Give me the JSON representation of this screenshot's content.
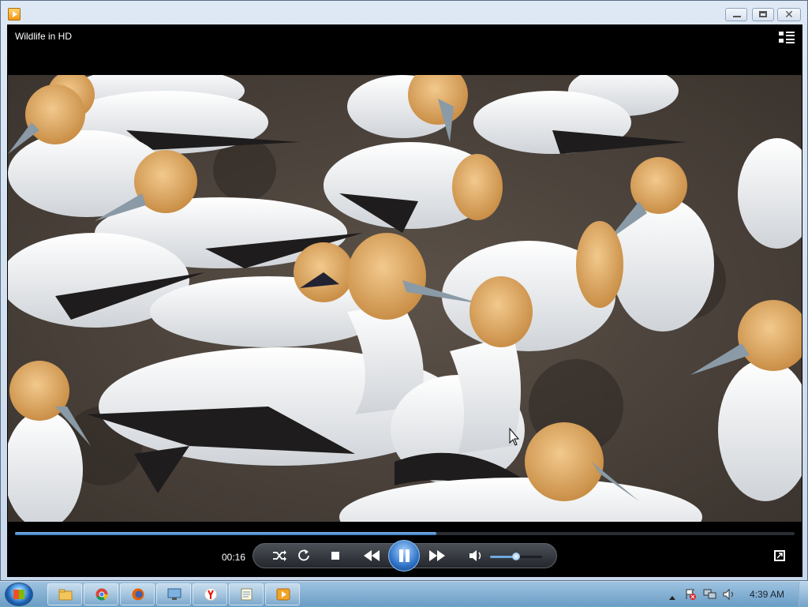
{
  "window": {
    "title": "Wildlife in HD",
    "icon": "media-player-icon",
    "buttons": [
      "minimize-icon",
      "maximize-icon",
      "close-icon"
    ],
    "close_glyph": "✕"
  },
  "player": {
    "current_time": "00:16",
    "progress_fraction": 0.54,
    "volume_fraction": 0.5,
    "state": "playing",
    "controls": [
      "shuffle-icon",
      "repeat-icon",
      "stop-icon",
      "previous-icon",
      "pause-icon",
      "next-icon",
      "volume-icon",
      "fullscreen-icon",
      "switch-to-library-icon"
    ],
    "accent": "#3a79c0"
  },
  "taskbar": {
    "clock": "4:39 AM",
    "pinned": [
      "windows-explorer",
      "google-chrome",
      "firefox",
      "remote-desktop",
      "yandex-browser",
      "notepad",
      "windows-media-player"
    ],
    "tray": [
      "show-hidden-icons",
      "action-center-icon",
      "network-icon",
      "volume-icon"
    ]
  }
}
